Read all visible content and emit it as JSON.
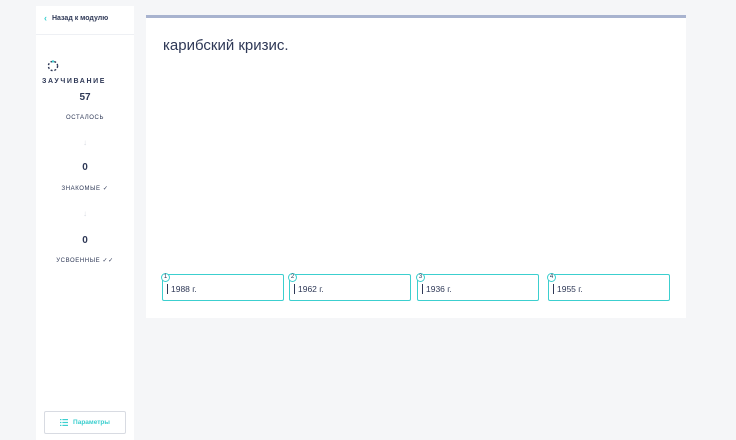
{
  "sidebar": {
    "back_label": "Назад к модулю",
    "mode_label": "ЗАУЧИВАНИЕ",
    "stats": [
      {
        "value": "57",
        "label": "ОСТАЛОСЬ"
      },
      {
        "value": "0",
        "label": "ЗНАКОМЫЕ ✓"
      },
      {
        "value": "0",
        "label": "УСВОЕННЫЕ ✓✓"
      }
    ],
    "params_label": "Параметры"
  },
  "question": {
    "prompt": "карибский кризис.",
    "options": [
      {
        "number": "1",
        "text": "1988 г."
      },
      {
        "number": "2",
        "text": "1962 г."
      },
      {
        "number": "3",
        "text": "1936 г."
      },
      {
        "number": "4",
        "text": "1955 г."
      }
    ]
  },
  "colors": {
    "accent": "#3ccfcf",
    "text": "#2e3856",
    "progress_bar": "#a8b3cf",
    "background": "#f5f6f8"
  },
  "icons": {
    "back": "chevron-left-icon",
    "mode": "spinner-icon",
    "arrow": "arrow-down-icon",
    "params": "settings-list-icon"
  }
}
